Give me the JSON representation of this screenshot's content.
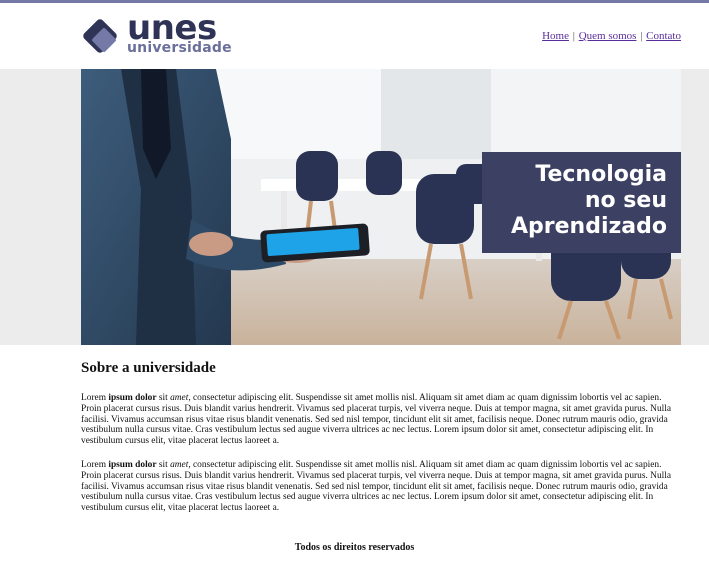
{
  "colors": {
    "accent_bar": "#7479a8",
    "brand_dark": "#2f3457",
    "brand_light": "#6a6f9b",
    "caption_bg": "#3c4062",
    "link": "#5a2d9c"
  },
  "header": {
    "logo": {
      "word": "unes",
      "sub": "universidade",
      "icon": "diamond-logo-icon"
    },
    "nav": [
      {
        "label": "Home"
      },
      {
        "label": "Quem somos"
      },
      {
        "label": "Contato"
      }
    ],
    "separator": "|"
  },
  "banner": {
    "caption_lines": [
      "Tecnologia",
      "no seu",
      "Aprendizado"
    ]
  },
  "main": {
    "title": "Sobre a universidade",
    "paragraphs": [
      {
        "p1": "Lorem ",
        "bold": "ipsum dolor",
        "p2": " sit ",
        "italic": "amet",
        "p3": ", consectetur adipiscing elit. Suspendisse sit amet mollis nisl. Aliquam sit amet diam ac quam dignissim lobortis vel ac sapien. Proin placerat cursus risus. Duis blandit varius hendrerit. Vivamus sed placerat turpis, vel viverra neque. Duis at tempor magna, sit amet gravida purus. Nulla facilisi. Vivamus accumsan risus vitae risus blandit venenatis. Sed sed nisl tempor, tincidunt elit sit amet, facilisis neque. Donec rutrum mauris odio, gravida vestibulum nulla cursus vitae. Cras vestibulum lectus sed augue viverra ultrices ac nec lectus. Lorem ipsum dolor sit amet, consectetur adipiscing elit. In vestibulum cursus elit, vitae placerat lectus laoreet a."
      },
      {
        "p1": "Lorem ",
        "bold": "ipsum dolor",
        "p2": " sit ",
        "italic": "amet",
        "p3": ", consectetur adipiscing elit. Suspendisse sit amet mollis nisl. Aliquam sit amet diam ac quam dignissim lobortis vel ac sapien. Proin placerat cursus risus. Duis blandit varius hendrerit. Vivamus sed placerat turpis, vel viverra neque. Duis at tempor magna, sit amet gravida purus. Nulla facilisi. Vivamus accumsan risus vitae risus blandit venenatis. Sed sed nisl tempor, tincidunt elit sit amet, facilisis neque. Donec rutrum mauris odio, gravida vestibulum nulla cursus vitae. Cras vestibulum lectus sed augue viverra ultrices ac nec lectus. Lorem ipsum dolor sit amet, consectetur adipiscing elit. In vestibulum cursus elit, vitae placerat lectus laoreet a."
      }
    ]
  },
  "footer": {
    "text": "Todos os direitos reservados"
  }
}
